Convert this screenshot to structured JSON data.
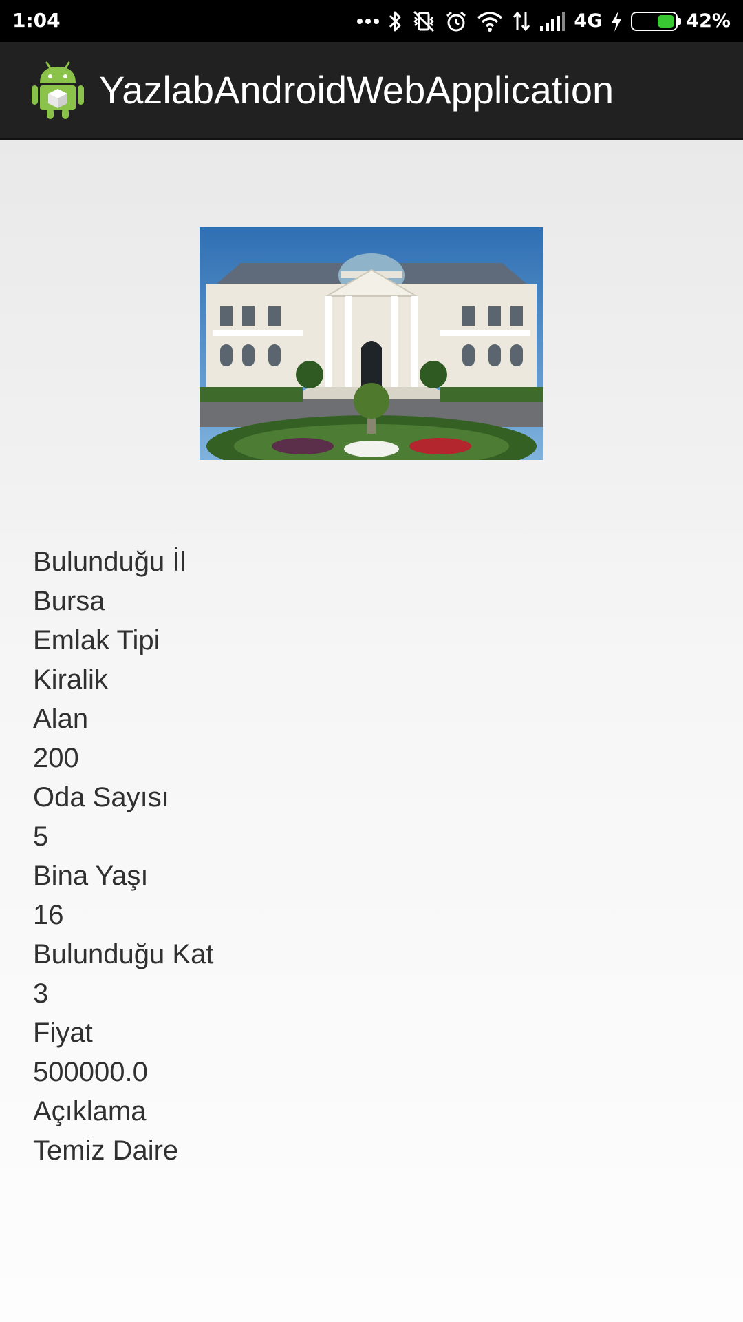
{
  "status_bar": {
    "time": "1:04",
    "network_type": "4G",
    "battery_percent_label": "42%",
    "battery_level": 0.42,
    "icons": [
      "more-dots-icon",
      "bluetooth-icon",
      "vibrate-off-icon",
      "alarm-icon",
      "wifi-icon",
      "data-arrows-icon",
      "signal-icon",
      "charging-icon",
      "battery-icon"
    ],
    "battery_color": "#37c832"
  },
  "action_bar": {
    "title": "YazlabAndroidWebApplication",
    "icon": "android-app-icon"
  },
  "property": {
    "image": "house-photo",
    "fields": [
      {
        "label": "Bulunduğu İl",
        "value": "Bursa"
      },
      {
        "label": "Emlak Tipi",
        "value": "Kiralik"
      },
      {
        "label": "Alan",
        "value": "200"
      },
      {
        "label": "Oda Sayısı",
        "value": "5"
      },
      {
        "label": "Bina Yaşı",
        "value": "16"
      },
      {
        "label": "Bulunduğu Kat",
        "value": "3"
      },
      {
        "label": "Fiyat",
        "value": "500000.0"
      },
      {
        "label": "Açıklama",
        "value": "Temiz Daire"
      }
    ]
  }
}
